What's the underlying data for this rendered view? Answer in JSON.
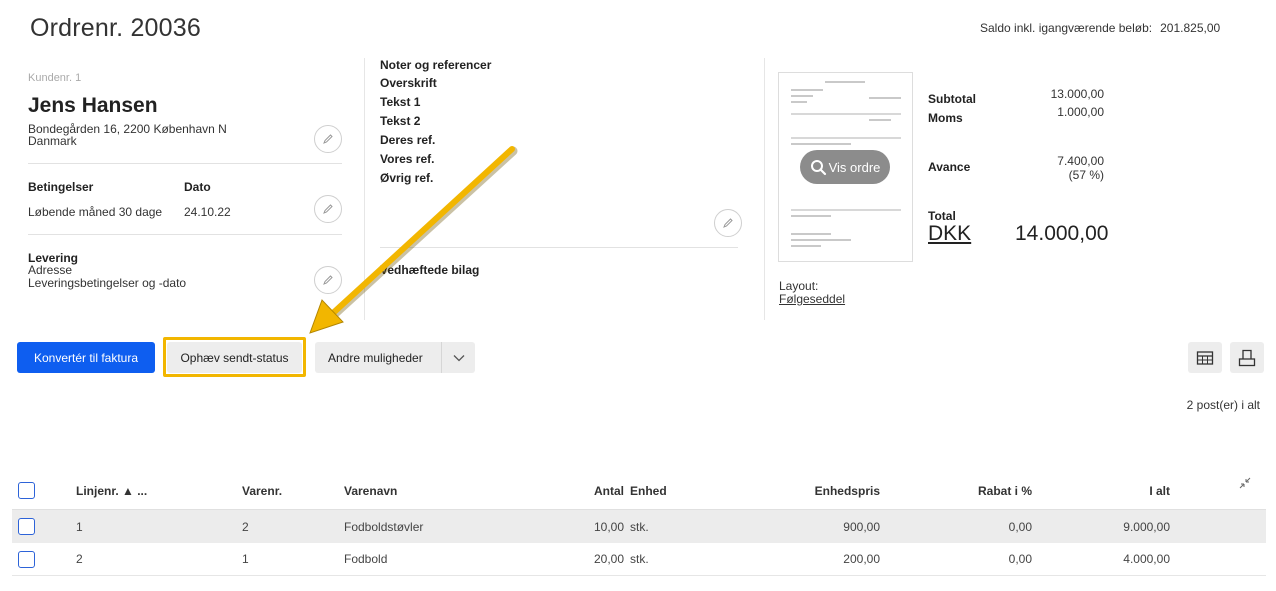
{
  "header": {
    "order_title": "Ordrenr. 20036",
    "saldo_label": "Saldo inkl. igangværende beløb:",
    "saldo_value": "201.825,00"
  },
  "customer": {
    "number": "Kundenr. 1",
    "name": "Jens Hansen",
    "address_line1": "Bondegården 16, 2200 København N",
    "address_line2": "Danmark"
  },
  "conditions": {
    "label": "Betingelser",
    "date_label": "Dato",
    "value": "Løbende måned 30 dage",
    "date_value": "24.10.22"
  },
  "delivery": {
    "title": "Levering",
    "line1": "Adresse",
    "line2": "Leveringsbetingelser og -dato"
  },
  "notes": {
    "title": "Noter og referencer",
    "items": [
      "Overskrift",
      "Tekst 1",
      "Tekst 2",
      "Deres ref.",
      "Vores ref.",
      "Øvrig ref."
    ],
    "attachments": "Vedhæftede bilag"
  },
  "preview": {
    "button_label": "Vis ordre",
    "layout_label": "Layout:",
    "layout_value": "Følgeseddel"
  },
  "totals": {
    "subtotal_label": "Subtotal",
    "subtotal_value": "13.000,00",
    "moms_label": "Moms",
    "moms_value": "1.000,00",
    "avance_label": "Avance",
    "avance_value": "7.400,00",
    "avance_pct": "(57 %)",
    "total_label": "Total",
    "currency": "DKK",
    "total_value": "14.000,00"
  },
  "actions": {
    "convert": "Konvertér til faktura",
    "revoke": "Ophæv sendt-status",
    "more": "Andre muligheder"
  },
  "post_count": "2 post(er) i alt",
  "table": {
    "headers": {
      "line": "Linjenr. ▲ ...",
      "item_no": "Varenr.",
      "item_name": "Varenavn",
      "qty": "Antal",
      "unit": "Enhed",
      "unit_price": "Enhedspris",
      "discount": "Rabat i %",
      "total": "I alt"
    },
    "rows": [
      {
        "line": "1",
        "item_no": "2",
        "item_name": "Fodboldstøvler",
        "qty": "10,00",
        "unit": "stk.",
        "unit_price": "900,00",
        "discount": "0,00",
        "total": "9.000,00"
      },
      {
        "line": "2",
        "item_no": "1",
        "item_name": "Fodbold",
        "qty": "20,00",
        "unit": "stk.",
        "unit_price": "200,00",
        "discount": "0,00",
        "total": "4.000,00"
      }
    ]
  },
  "colors": {
    "primary": "#0e5ef0",
    "highlight": "#f2b600",
    "checkbox": "#2d63d8"
  }
}
